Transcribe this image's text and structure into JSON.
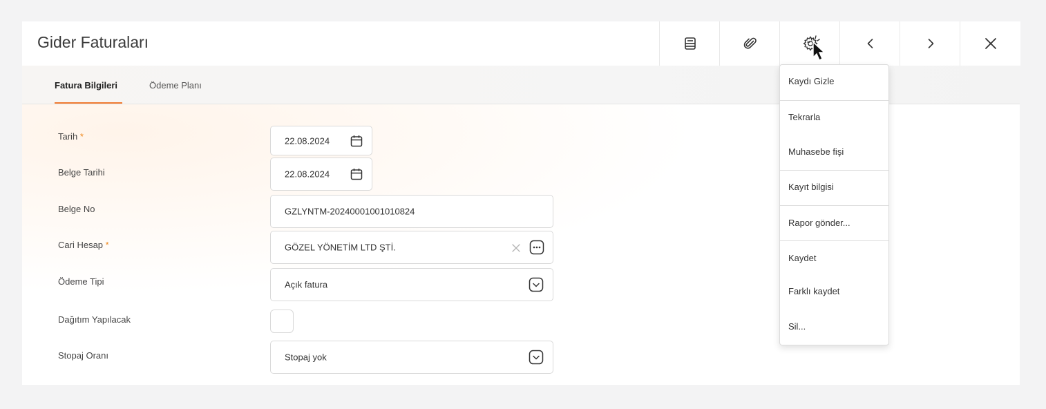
{
  "window": {
    "title": "Gider Faturaları"
  },
  "toolbar": {
    "buttons": [
      {
        "name": "print-icon"
      },
      {
        "name": "paperclip-icon"
      },
      {
        "name": "gear-icon"
      },
      {
        "name": "chevron-left-icon"
      },
      {
        "name": "chevron-right-icon"
      },
      {
        "name": "close-icon"
      }
    ]
  },
  "tabs": [
    {
      "label": "Fatura Bilgileri",
      "active": true
    },
    {
      "label": "Ödeme Planı",
      "active": false
    }
  ],
  "form": {
    "tarih": {
      "label": "Tarih",
      "required_mark": "*",
      "value": "22.08.2024"
    },
    "belge_tarihi": {
      "label": "Belge Tarihi",
      "value": "22.08.2024"
    },
    "belge_no": {
      "label": "Belge No",
      "value": "GZLYNTM-20240001001010824"
    },
    "cari_hesap": {
      "label": "Cari Hesap",
      "required_mark": "*",
      "value": "GÖZEL YÖNETİM LTD ŞTİ."
    },
    "odeme_tipi": {
      "label": "Ödeme Tipi",
      "value": "Açık fatura"
    },
    "dagitim": {
      "label": "Dağıtım Yapılacak",
      "checked": false
    },
    "stopaj": {
      "label": "Stopaj Oranı",
      "value": "Stopaj yok"
    }
  },
  "menu": {
    "items": [
      {
        "label": "Kaydı Gizle"
      },
      {
        "label": "Tekrarla"
      },
      {
        "label": "Muhasebe fişi"
      },
      {
        "label": "Kayıt bilgisi"
      },
      {
        "label": "Rapor gönder..."
      },
      {
        "label": "Kaydet"
      },
      {
        "label": "Farklı kaydet"
      },
      {
        "label": "Sil..."
      }
    ]
  },
  "colors": {
    "accent": "#f07a30",
    "required": "#f08a20"
  }
}
